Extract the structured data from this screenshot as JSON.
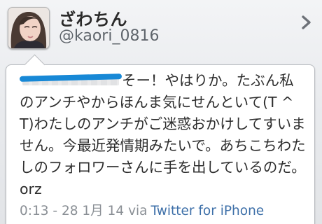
{
  "profile": {
    "display_name": "ざわちん",
    "username": "@kaori_0816",
    "avatar_icon": "user-photo-avatar",
    "chevron_icon": "chevron-right-icon"
  },
  "tweet": {
    "mention_redacted": true,
    "text": "そー！やはりか。たぶん私のアンチやからほんま気にせんといて(T ^ T)わたしのアンチがご迷惑おかけしてすいません。今最近発情期みたいで。あちこちわたしのフォロワーさんに手を出しているのだ。orz",
    "timestamp": "0:13 - 28 1月 14",
    "via_label": "via",
    "source": "Twitter for iPhone"
  },
  "colors": {
    "background": "#e9ebee",
    "link": "#3d6fa8",
    "redaction": "#1788d6",
    "muted": "#8a8f95"
  }
}
